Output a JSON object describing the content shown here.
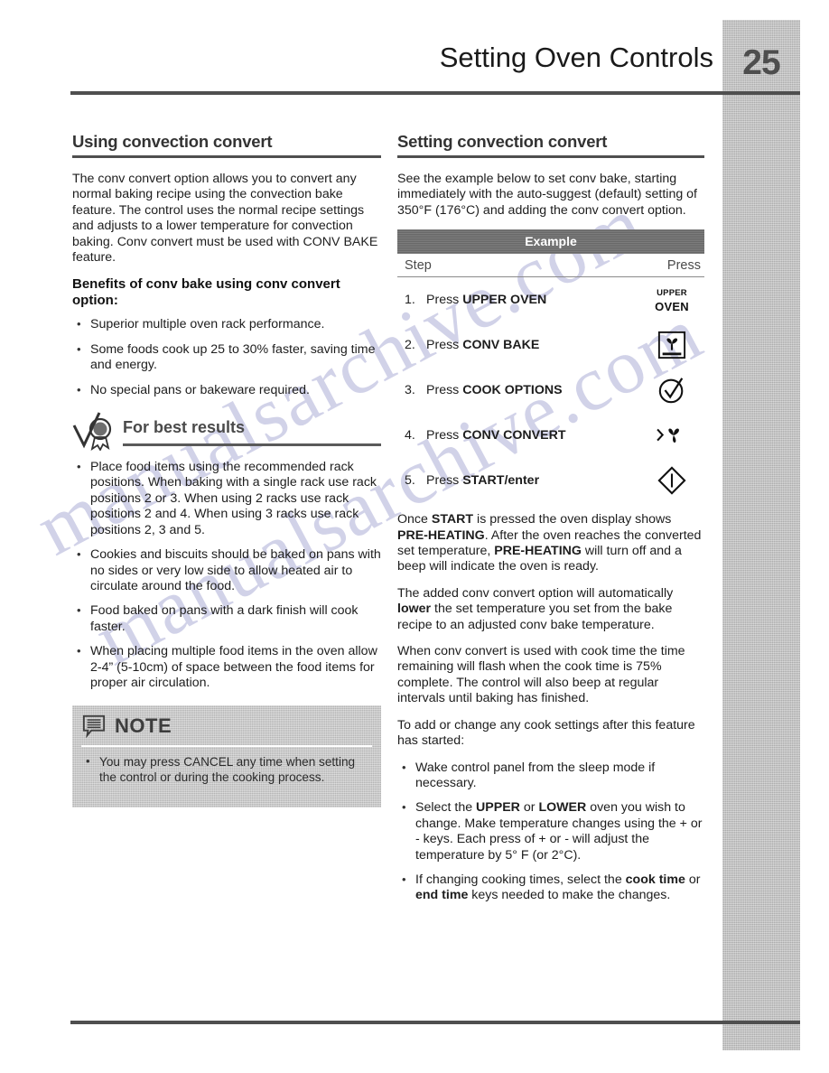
{
  "header": {
    "title": "Setting Oven Controls",
    "page_number": "25"
  },
  "watermark": {
    "line1": "manualsarchive.com",
    "line2": "manualsarchive.com"
  },
  "left_column": {
    "section_title": "Using convection convert",
    "intro": "The  conv convert option allows you to convert any normal baking recipe using the convection bake feature. The control uses the normal recipe settings and adjusts to a lower temperature for convection baking. Conv convert must be used with CONV BAKE feature.",
    "benefits_heading": "Benefits of conv bake using conv convert option:",
    "benefits": [
      "Superior multiple oven rack performance.",
      "Some foods cook up 25 to 30% faster, saving time and energy.",
      "No special pans or bakeware required."
    ],
    "best_results": {
      "title": "For best results",
      "icon": "award-checkmark-icon",
      "items": [
        "Place food items using the recommended rack positions. When baking with a single rack use rack positions 2 or 3. When using 2 racks use rack positions  2 and 4. When using 3 racks use rack positions 2, 3 and 5.",
        "Cookies and biscuits should be baked on pans with no sides or very low side to allow heated air to circulate around the food.",
        "Food baked on pans with a dark finish will cook faster.",
        "When placing multiple food items in the oven allow 2-4” (5-10cm) of space between the food items for proper air circulation."
      ]
    },
    "note": {
      "title": "NOTE",
      "icon": "note-speech-bubble-icon",
      "items": [
        "You may press CANCEL any time when setting the control or during the cooking process."
      ]
    }
  },
  "right_column": {
    "section_title": "Setting convection convert",
    "intro": "See the example below to set conv bake, starting immediately with the auto-suggest (default) setting of 350°F (176°C) and adding the conv convert option.",
    "example_table": {
      "header": "Example",
      "col_step": "Step",
      "col_press": "Press",
      "rows": [
        {
          "num": "1.",
          "text_pre": "Press ",
          "text_bold": "UPPER OVEN",
          "key_icon": "upper-oven-key-icon",
          "key_line1": "UPPER",
          "key_line2": "OVEN"
        },
        {
          "num": "2.",
          "text_pre": "Press ",
          "text_bold": "CONV BAKE",
          "key_icon": "conv-bake-fan-in-box-icon"
        },
        {
          "num": "3.",
          "text_pre": "Press ",
          "text_bold": "COOK OPTIONS",
          "key_icon": "cook-options-check-circle-icon"
        },
        {
          "num": "4.",
          "text_pre": "Press ",
          "text_bold": "CONV CONVERT",
          "key_icon": "conv-convert-fan-arrow-icon"
        },
        {
          "num": "5.",
          "text_pre": "Press ",
          "text_bold": "START/enter",
          "key_icon": "start-enter-diamond-icon"
        }
      ]
    },
    "para_start_pre": "Once ",
    "para_start_b1": "START",
    "para_start_mid1": " is pressed the oven display shows ",
    "para_start_b2": "PRE-HEATING",
    "para_start_mid2": ". After the oven reaches the converted set temperature, ",
    "para_start_b3": "PRE-HEATING",
    "para_start_end": " will turn off and a beep will indicate the oven is ready.",
    "para_lower_pre": "The added conv convert option will automatically ",
    "para_lower_b": "lower",
    "para_lower_end": " the set temperature you set from the bake recipe to an adjusted conv bake temperature.",
    "para_cooktime": "When conv convert is used with cook time the time remaining will flash when the cook time is 75% complete. The control will also beep at regular intervals until baking has finished.",
    "para_change_intro": "To add or change any cook settings after this feature has started:",
    "change_bullets": [
      {
        "pre": "Wake control panel from the sleep mode if necessary.",
        "b1": "",
        "mid": "",
        "b2": "",
        "end": ""
      },
      {
        "pre": "Select the ",
        "b1": "UPPER",
        "mid": " or ",
        "b2": "LOWER",
        "end": " oven you wish to change. Make temperature changes using the + or - keys. Each press of + or - will adjust the temperature by 5° F (or 2°C)."
      },
      {
        "pre": "If changing cooking times, select the ",
        "b1": "cook time",
        "mid": " or ",
        "b2": "end time",
        "end": " keys needed to make the changes."
      }
    ]
  },
  "colors": {
    "rule": "#4f4f4f",
    "side_tab": "#b9b9b9",
    "note_bg": "#c2c2c2",
    "example_header_bg": "#6d6d6d",
    "heading_text": "#333333"
  }
}
